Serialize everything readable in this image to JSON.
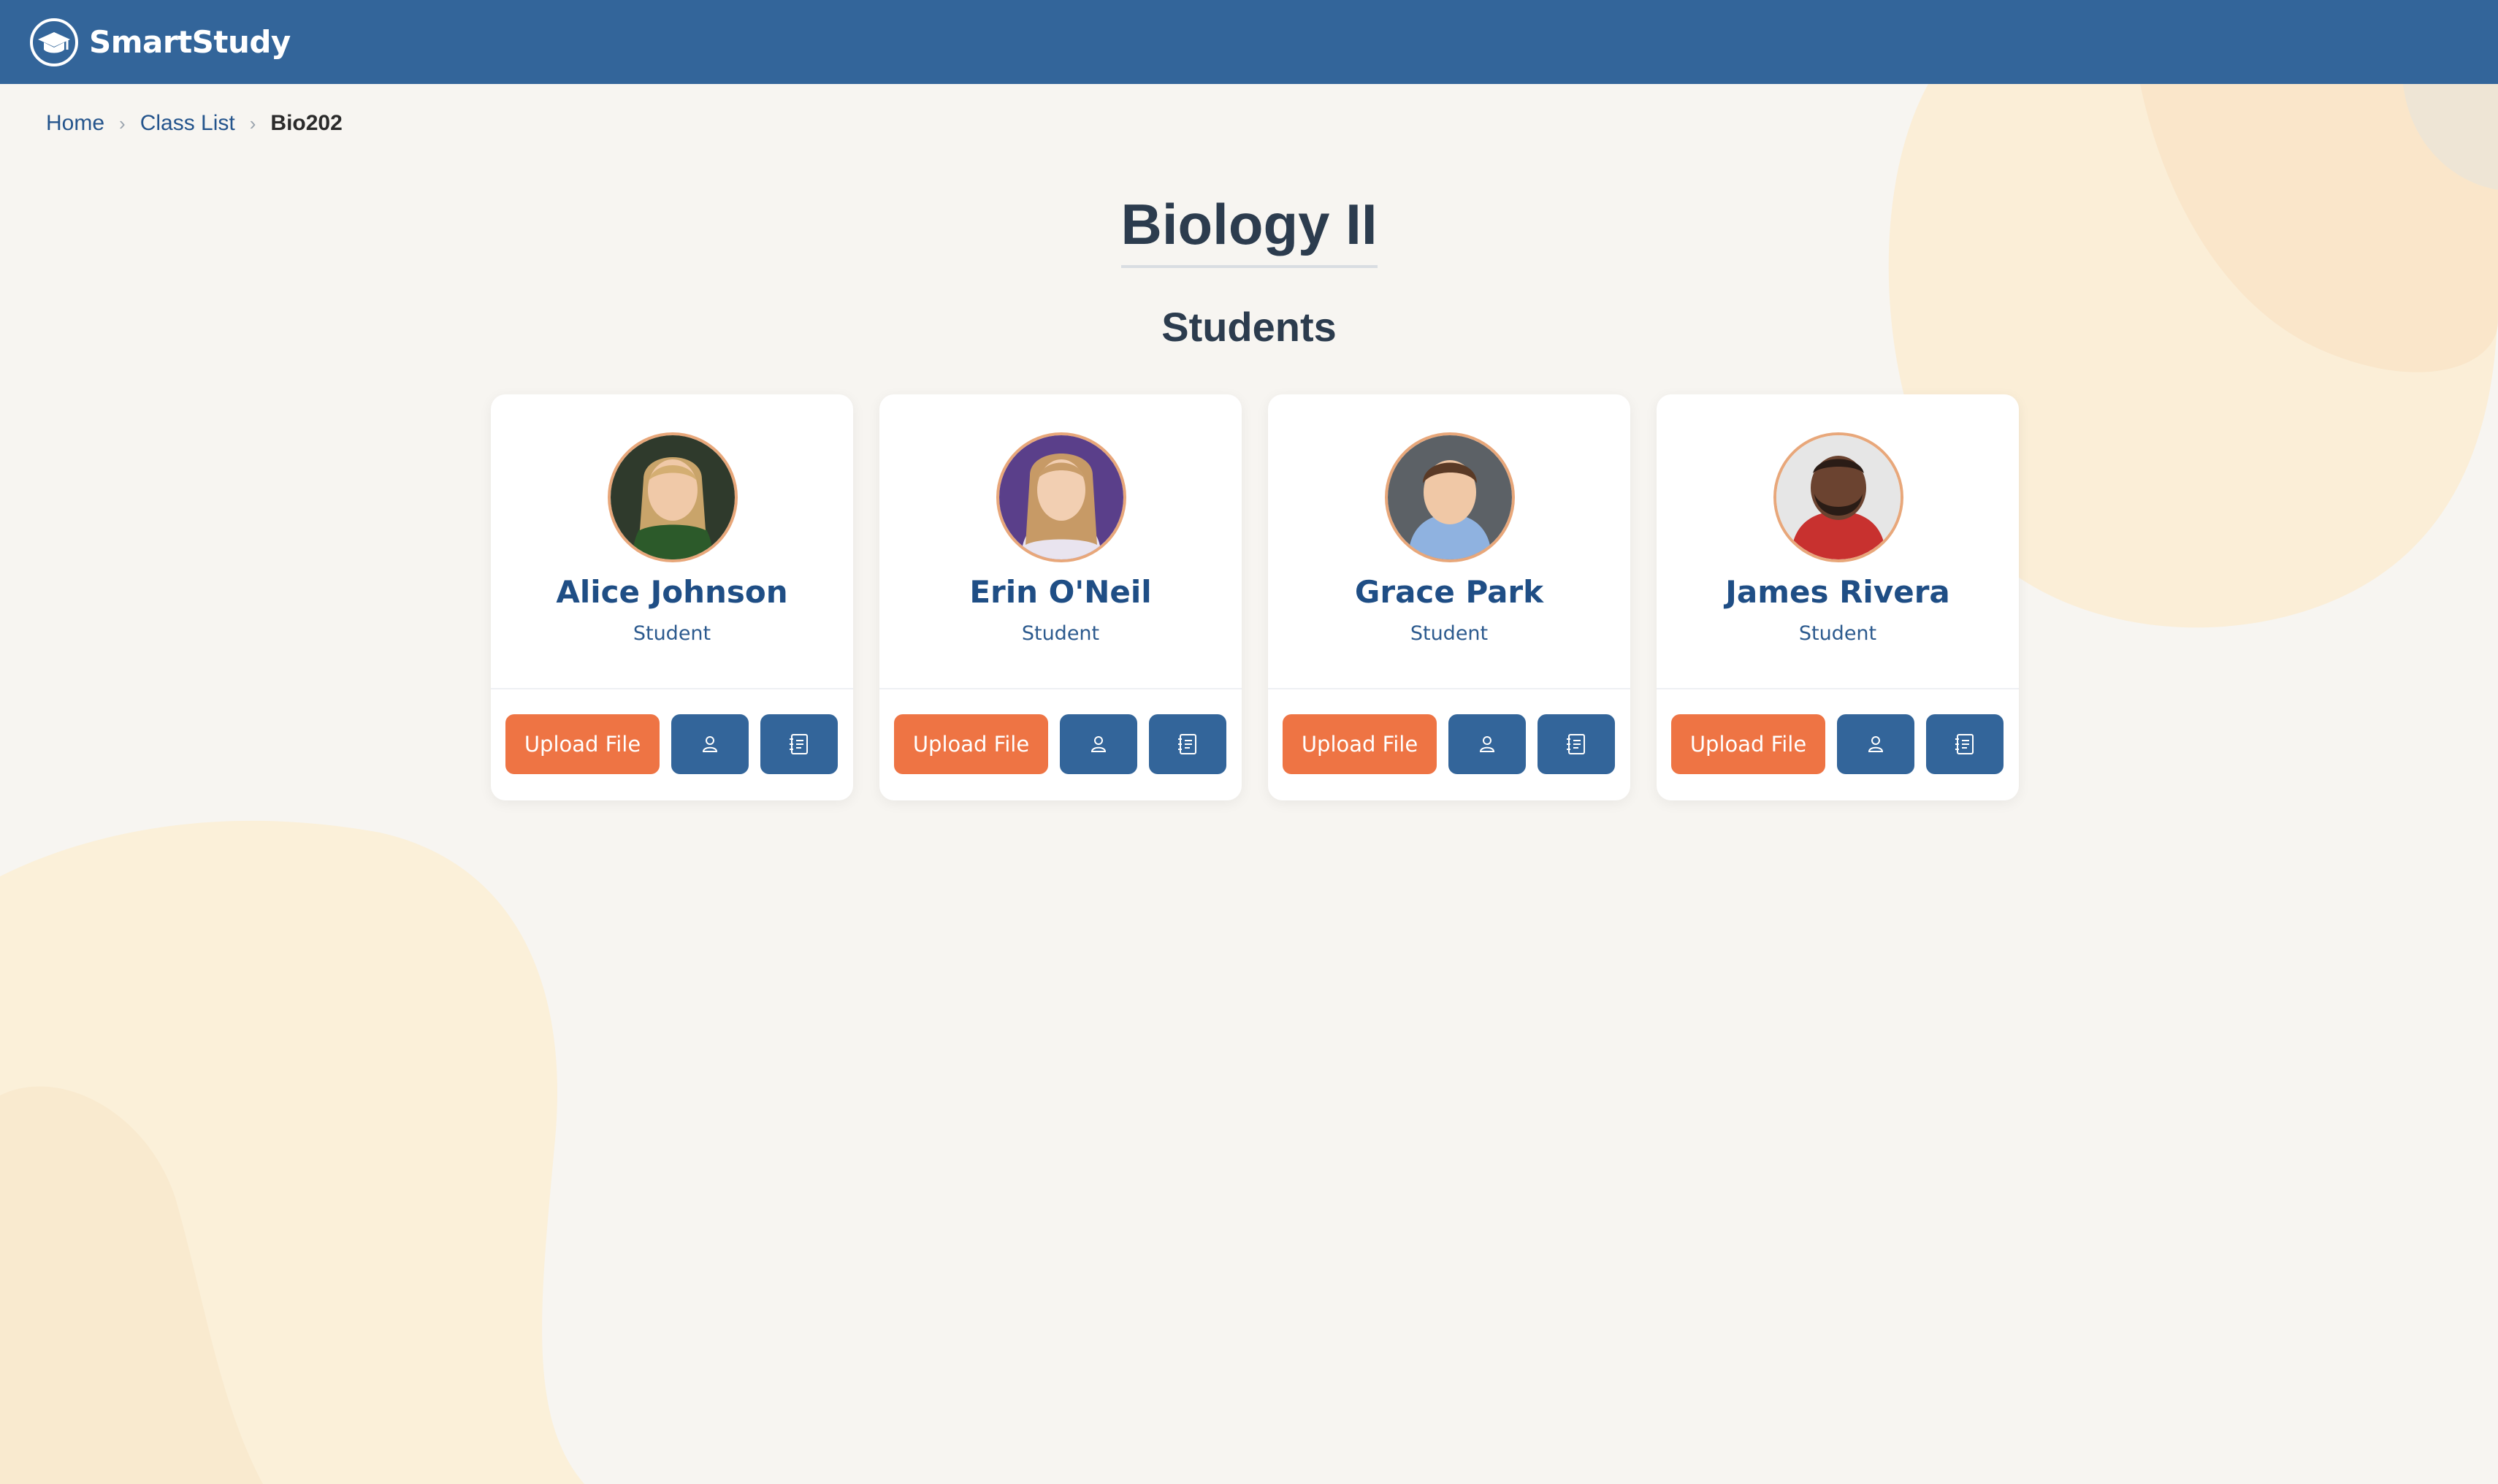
{
  "app": {
    "brand_name": "SmartStudy"
  },
  "breadcrumb": {
    "items": [
      {
        "label": "Home"
      },
      {
        "label": "Class List"
      }
    ],
    "current": "Bio202"
  },
  "page": {
    "title": "Biology II",
    "section_title": "Students"
  },
  "students": [
    {
      "name": "Alice Johnson",
      "role": "Student",
      "upload_label": "Upload File",
      "profile_icon": "user-icon",
      "notes_icon": "notebook-icon"
    },
    {
      "name": "Erin O'Neil",
      "role": "Student",
      "upload_label": "Upload File",
      "profile_icon": "user-icon",
      "notes_icon": "notebook-icon"
    },
    {
      "name": "Grace Park",
      "role": "Student",
      "upload_label": "Upload File",
      "profile_icon": "user-icon",
      "notes_icon": "notebook-icon"
    },
    {
      "name": "James Rivera",
      "role": "Student",
      "upload_label": "Upload File",
      "profile_icon": "user-icon",
      "notes_icon": "notebook-icon"
    }
  ],
  "colors": {
    "header": "#33659a",
    "accent": "#ee7444",
    "name_text": "#1f4e85",
    "background": "#f7f5f1",
    "avatar_border": "#e8a77a"
  }
}
